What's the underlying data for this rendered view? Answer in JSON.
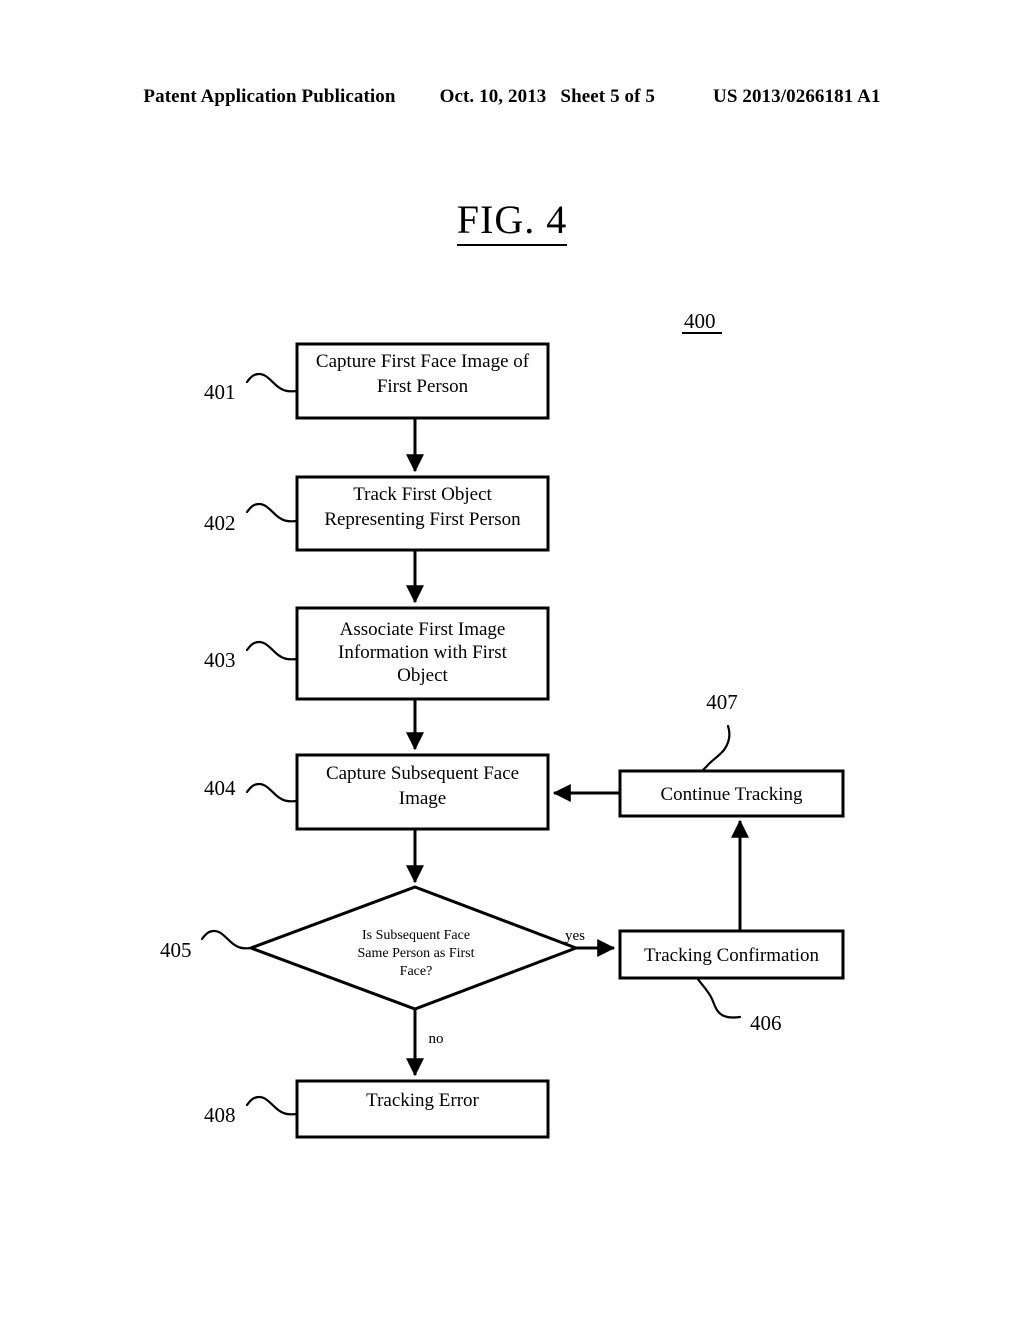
{
  "header": {
    "publication": "Patent Application Publication",
    "date": "Oct. 10, 2013",
    "sheet": "Sheet 5 of 5",
    "patent_number": "US 2013/0266181 A1"
  },
  "figure": {
    "title": "FIG. 4",
    "diagram_reference": "400"
  },
  "flowchart": {
    "nodes": [
      {
        "ref": "401",
        "label_line1": "Capture First Face Image of",
        "label_line2": "First Person",
        "shape": "rect"
      },
      {
        "ref": "402",
        "label_line1": "Track First Object",
        "label_line2": "Representing First Person",
        "shape": "rect"
      },
      {
        "ref": "403",
        "label_line1": "Associate First Image",
        "label_line2": "Information with First",
        "label_line3": "Object",
        "shape": "rect"
      },
      {
        "ref": "404",
        "label_line1": "Capture Subsequent Face",
        "label_line2": "Image",
        "shape": "rect"
      },
      {
        "ref": "405",
        "label_line1": "Is Subsequent Face",
        "label_line2": "Same Person as First",
        "label_line3": "Face?",
        "shape": "diamond"
      },
      {
        "ref": "406",
        "label_line1": "Tracking Confirmation",
        "shape": "rect"
      },
      {
        "ref": "407",
        "label_line1": "Continue Tracking",
        "shape": "rect"
      },
      {
        "ref": "408",
        "label_line1": "Tracking Error",
        "shape": "rect"
      }
    ],
    "edge_labels": {
      "yes": "yes",
      "no": "no"
    }
  }
}
